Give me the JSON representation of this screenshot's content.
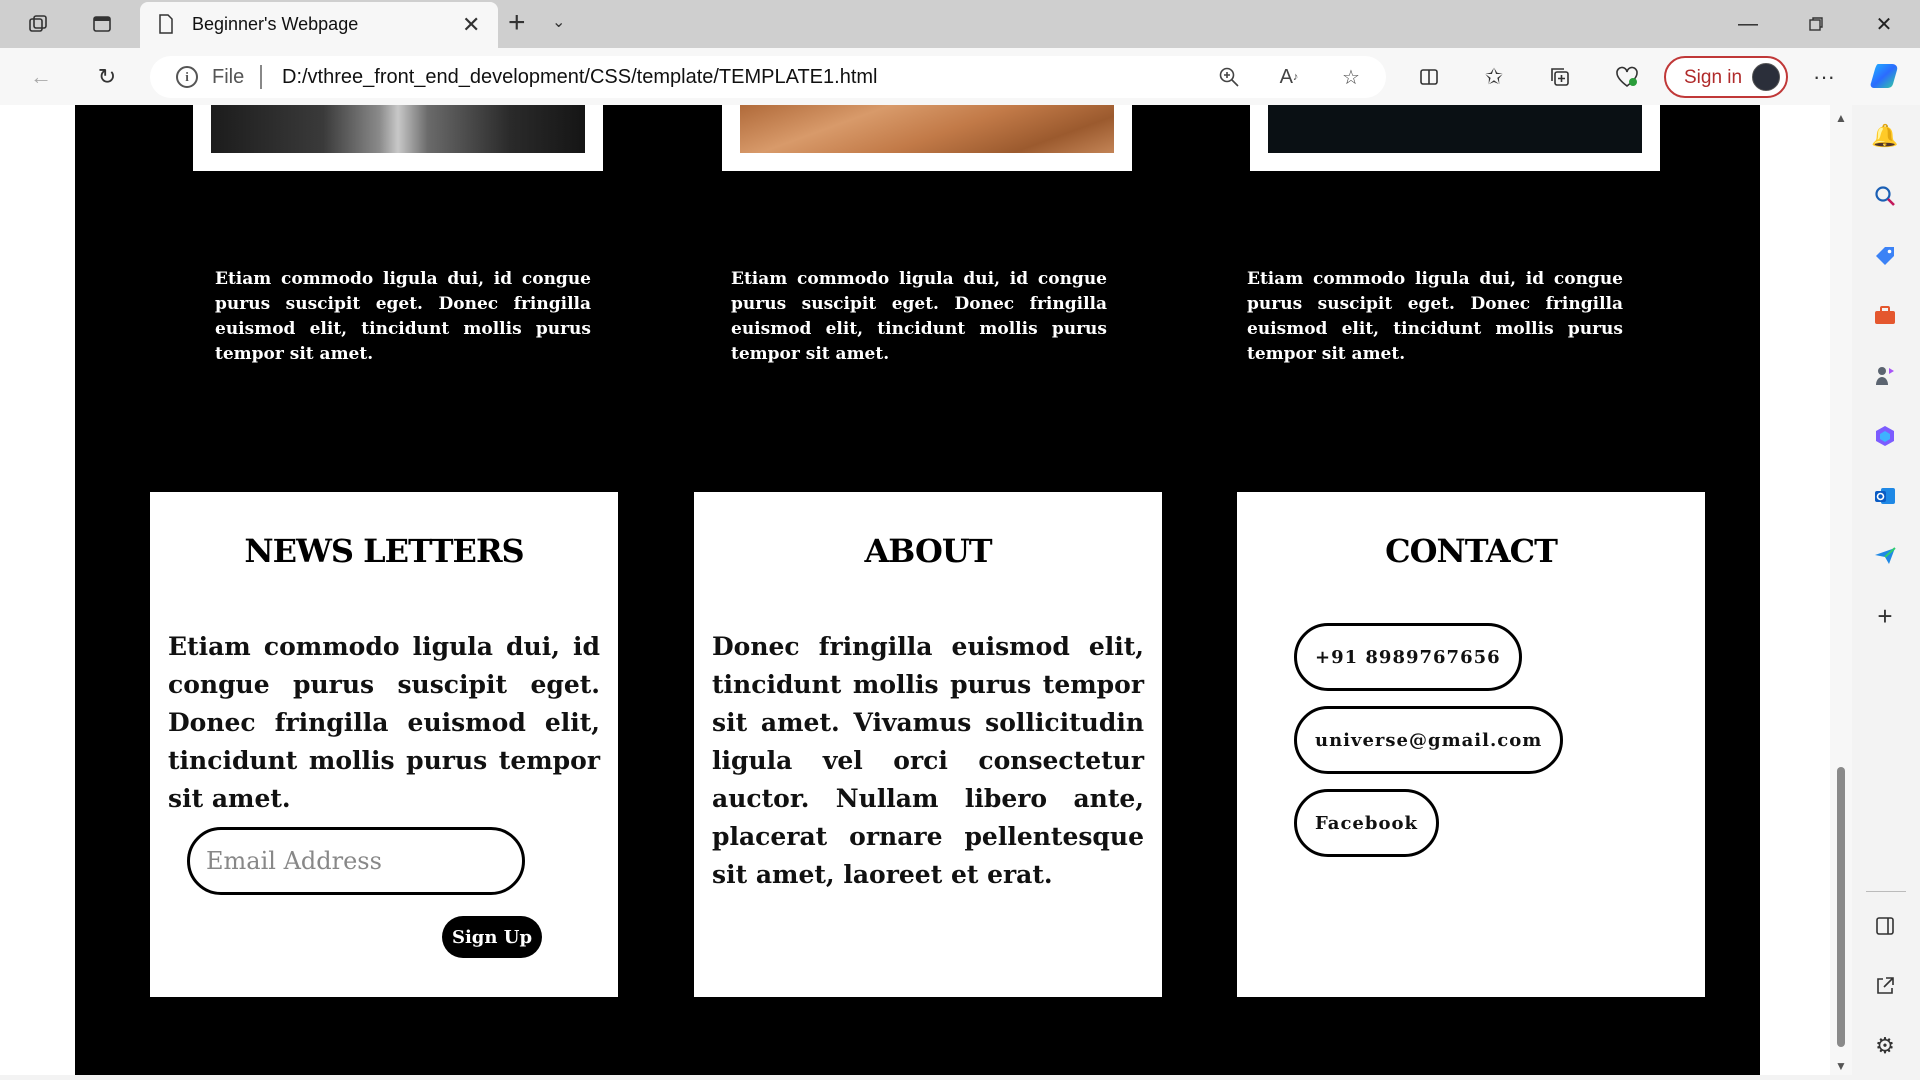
{
  "browser": {
    "tab_title": "Beginner's Webpage",
    "address": {
      "scheme_label": "File",
      "url": "D:/vthree_front_end_development/CSS/template/TEMPLATE1.html"
    },
    "signin_label": "Sign in",
    "accent_color": "#c03838"
  },
  "page": {
    "blurbs": [
      "Etiam commodo ligula dui, id congue purus suscipit eget. Donec fringilla euismod elit, tincidunt mollis purus tempor sit amet.",
      "Etiam commodo ligula dui, id congue purus suscipit eget. Donec fringilla euismod elit, tincidunt mollis purus tempor sit amet.",
      "Etiam commodo ligula dui, id congue purus suscipit eget. Donec fringilla euismod elit, tincidunt mollis purus tempor sit amet."
    ],
    "newsletter": {
      "title": "NEWS LETTERS",
      "text": "Etiam commodo ligula dui, id congue purus suscipit eget. Donec fringilla euismod elit, tincidunt mollis purus tempor sit amet.",
      "email_placeholder": "Email Address",
      "signup_label": "Sign Up"
    },
    "about": {
      "title": "ABOUT",
      "text": "Donec fringilla euismod elit, tincidunt mollis purus tempor sit amet. Vivamus sollicitudin ligula vel orci consectetur auctor. Nullam libero ante, placerat ornare pellentesque sit amet, laoreet et erat."
    },
    "contact": {
      "title": "CONTACT",
      "phone": "+91 8989767656",
      "email": "universe@gmail.com",
      "social": "Facebook"
    }
  }
}
